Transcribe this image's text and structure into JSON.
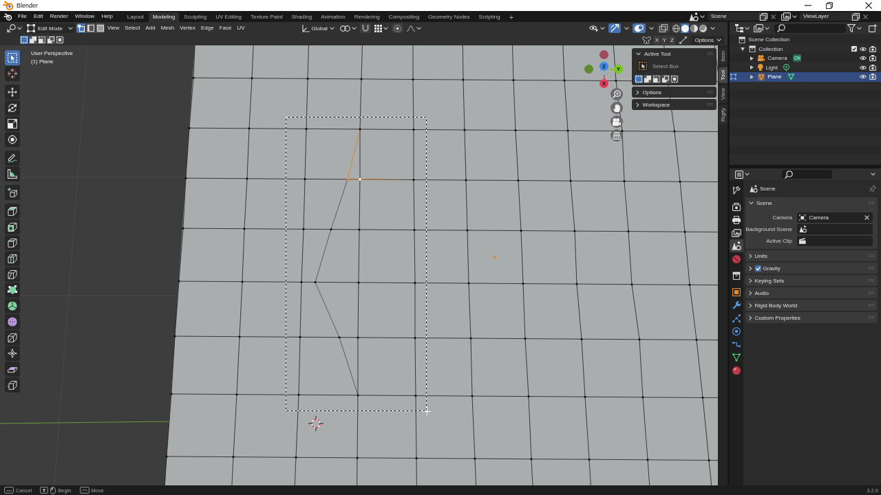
{
  "window": {
    "title": "Blender"
  },
  "topbar": {
    "menus": [
      "File",
      "Edit",
      "Render",
      "Window",
      "Help"
    ],
    "workspaces": [
      {
        "label": "Layout",
        "selected": false
      },
      {
        "label": "Modeling",
        "selected": true
      },
      {
        "label": "Sculpting",
        "selected": false
      },
      {
        "label": "UV Editing",
        "selected": false
      },
      {
        "label": "Texture Paint",
        "selected": false
      },
      {
        "label": "Shading",
        "selected": false
      },
      {
        "label": "Animation",
        "selected": false
      },
      {
        "label": "Rendering",
        "selected": false
      },
      {
        "label": "Compositing",
        "selected": false
      },
      {
        "label": "Geometry Nodes",
        "selected": false
      },
      {
        "label": "Scripting",
        "selected": false
      }
    ],
    "add_workspace": "+",
    "scene": "Scene",
    "view_layer": "ViewLayer"
  },
  "viewport": {
    "header": {
      "mode": "Edit Mode",
      "select_modes": [
        {
          "selected": true
        },
        {
          "selected": false
        },
        {
          "selected": false
        }
      ],
      "menus": [
        "View",
        "Select",
        "Add",
        "Mesh",
        "Vertex",
        "Edge",
        "Face",
        "UV"
      ],
      "orientation": "Global",
      "shading_modes": [
        {
          "selected": false
        },
        {
          "selected": true
        },
        {
          "selected": false
        },
        {
          "selected": false
        }
      ]
    },
    "tool_settings": {
      "select_operations": [
        {
          "selected": true
        },
        {
          "selected": false
        },
        {
          "selected": false
        },
        {
          "selected": false
        },
        {
          "selected": false
        }
      ],
      "mirror_axes": [
        {
          "label": "X",
          "on": false
        },
        {
          "label": "Y",
          "on": false
        },
        {
          "label": "Z",
          "on": false
        }
      ],
      "options": "Options"
    },
    "view_name": "User Perspective",
    "object_name": "(1) Plane",
    "toolbar": [
      {
        "selected": true
      },
      {
        "selected": false
      },
      {
        "selected": false
      },
      {
        "selected": false
      },
      {
        "selected": false
      },
      {
        "selected": false
      },
      {
        "selected": false
      },
      {
        "selected": false
      },
      {
        "selected": false
      },
      {
        "selected": false
      },
      {
        "selected": false
      },
      {
        "selected": false
      },
      {
        "selected": false
      },
      {
        "selected": false
      },
      {
        "selected": false
      },
      {
        "selected": false
      },
      {
        "selected": false
      },
      {
        "selected": false
      },
      {
        "selected": false
      },
      {
        "selected": false
      },
      {
        "selected": false
      }
    ],
    "gizmo": [
      {
        "kind": "negative",
        "color": "#a0485c"
      },
      {
        "kind": "negative",
        "color": "#5e8a2c"
      },
      {
        "kind": "positive",
        "label": "Z",
        "color": "#3a87e6"
      },
      {
        "kind": "positive",
        "label": "Y",
        "color": "#7ac61e"
      },
      {
        "kind": "positive",
        "label": "X",
        "color": "#e23a5a"
      }
    ],
    "sidebar": {
      "panels": [
        {
          "title": "Active Tool",
          "expanded": true,
          "tool": "Select Box",
          "select_operations": [
            {
              "selected": true
            },
            {
              "selected": false
            },
            {
              "selected": false
            },
            {
              "selected": false
            },
            {
              "selected": false
            }
          ]
        },
        {
          "title": "Options",
          "expanded": false
        },
        {
          "title": "Workspace",
          "expanded": false
        }
      ],
      "tabs": [
        {
          "label": "Item",
          "selected": false
        },
        {
          "label": "Tool",
          "selected": true
        },
        {
          "label": "View",
          "selected": false
        },
        {
          "label": "Rigify",
          "selected": false
        }
      ]
    }
  },
  "outliner": {
    "root": {
      "label": "Scene Collection",
      "kind": "collection",
      "children": [
        {
          "label": "Collection",
          "kind": "collection",
          "expanded": true,
          "selected": false,
          "editing": false,
          "checkbox": {
            "checked": true
          },
          "visible": true,
          "renderable": true,
          "children": [
            {
              "label": "Camera",
              "kind": "camera",
              "expanded": false,
              "selected": false,
              "editing": false,
              "visible": true,
              "renderable": true
            },
            {
              "label": "Light",
              "kind": "light",
              "expanded": false,
              "selected": false,
              "editing": false,
              "visible": true,
              "renderable": true
            },
            {
              "label": "Plane",
              "kind": "mesh",
              "expanded": false,
              "selected": true,
              "editing": true,
              "visible": true,
              "renderable": true
            }
          ]
        }
      ]
    }
  },
  "properties": {
    "tabs": [
      {
        "selected": false
      },
      {
        "selected": false
      },
      {
        "selected": false
      },
      {
        "selected": false
      },
      {
        "selected": true
      },
      {
        "selected": false
      },
      {
        "selected": false
      },
      {
        "selected": false
      },
      {
        "selected": false
      },
      {
        "selected": false
      },
      {
        "selected": false
      },
      {
        "selected": false
      },
      {
        "selected": false
      },
      {
        "selected": false
      }
    ],
    "context": "Scene",
    "panels": [
      {
        "title": "Scene",
        "expanded": true,
        "fields": [
          {
            "label": "Camera",
            "kind": "object",
            "value": "Camera"
          },
          {
            "label": "Background Scene",
            "kind": "scene"
          },
          {
            "label": "Active Clip",
            "kind": "clip"
          }
        ]
      },
      {
        "title": "Units",
        "expanded": false
      },
      {
        "title": "Gravity",
        "expanded": false,
        "toggle": {
          "checked": true
        }
      },
      {
        "title": "Keying Sets",
        "expanded": false
      },
      {
        "title": "Audio",
        "expanded": false
      },
      {
        "title": "Rigid Body World",
        "expanded": false
      },
      {
        "title": "Custom Properties",
        "expanded": false
      }
    ]
  },
  "status_bar": {
    "hints": [
      {
        "kind": "key",
        "label": "Cancel"
      },
      {
        "kind": "shift_mouse",
        "label": "Begin"
      },
      {
        "kind": "mouse",
        "label": "Move"
      }
    ],
    "version": "3.2.0"
  }
}
